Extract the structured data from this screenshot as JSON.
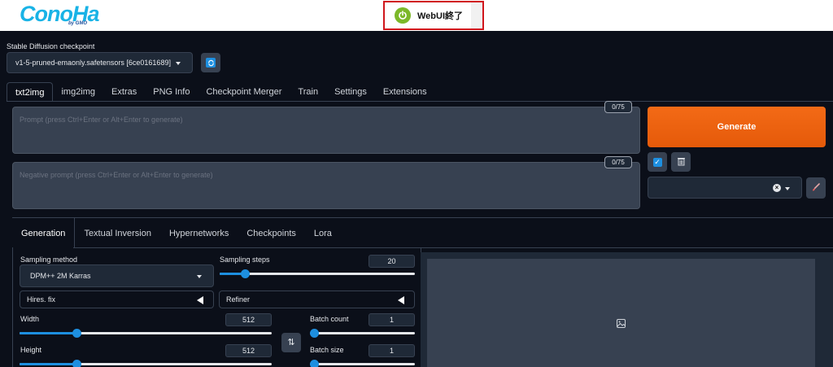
{
  "header": {
    "logo_text": "ConoHa",
    "logo_sub": "by GMO",
    "quit_button": "WebUI終了"
  },
  "checkpoint": {
    "label": "Stable Diffusion checkpoint",
    "value": "v1-5-pruned-emaonly.safetensors [6ce0161689]"
  },
  "main_tabs": [
    "txt2img",
    "img2img",
    "Extras",
    "PNG Info",
    "Checkpoint Merger",
    "Train",
    "Settings",
    "Extensions"
  ],
  "prompt": {
    "placeholder": "Prompt (press Ctrl+Enter or Alt+Enter to generate)",
    "counter": "0/75"
  },
  "negative_prompt": {
    "placeholder": "Negative prompt (press Ctrl+Enter or Alt+Enter to generate)",
    "counter": "0/75"
  },
  "generate_label": "Generate",
  "sub_tabs": [
    "Generation",
    "Textual Inversion",
    "Hypernetworks",
    "Checkpoints",
    "Lora"
  ],
  "generation": {
    "sampling_method_label": "Sampling method",
    "sampling_method_value": "DPM++ 2M Karras",
    "sampling_steps_label": "Sampling steps",
    "sampling_steps_value": "20",
    "sampling_steps": {
      "value": 20,
      "min": 1,
      "max": 150
    },
    "hires_fix_label": "Hires. fix",
    "refiner_label": "Refiner",
    "width_label": "Width",
    "width_value": "512",
    "width": {
      "value": 512,
      "min": 64,
      "max": 2048
    },
    "height_label": "Height",
    "height_value": "512",
    "height": {
      "value": 512,
      "min": 64,
      "max": 2048
    },
    "batch_count_label": "Batch count",
    "batch_count_value": "1",
    "batch_count": {
      "value": 1,
      "min": 1,
      "max": 100
    },
    "batch_size_label": "Batch size",
    "batch_size_value": "1",
    "batch_size": {
      "value": 1,
      "min": 1,
      "max": 8
    }
  },
  "colors": {
    "accent": "#1d8fe0",
    "generate": "#f1620f",
    "background": "#0b0f19",
    "highlight_border": "#d0161c"
  },
  "icons": {
    "power": "power-icon",
    "refresh": "refresh-icon",
    "trash": "trash-icon",
    "brush": "brush-icon",
    "image": "image-icon",
    "swap": "swap-icon"
  }
}
